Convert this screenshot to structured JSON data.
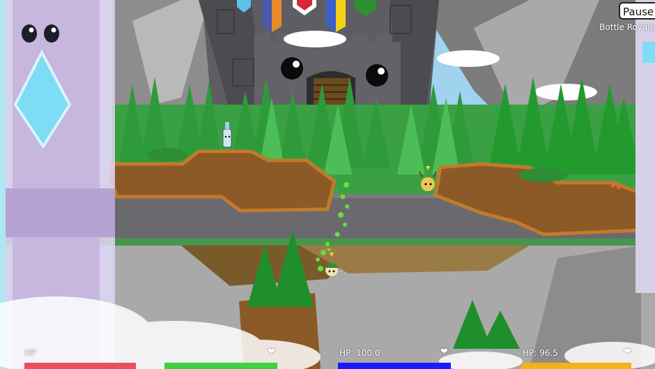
{
  "hud": {
    "pause_label": "Pause",
    "mode_label": "Bottle Royale",
    "players": [
      {
        "hp_label": "HP",
        "heart_icon": "heart-icon",
        "bar_color": "#e8505b",
        "fill_color": "#3fd13f"
      },
      {
        "hp_label": "HP: 100.0",
        "heart_icon": "heart-icon",
        "bar_color": "#1a1aff"
      },
      {
        "hp_label": "HP: 96.5",
        "heart_icon": "heart-icon",
        "bar_color": "#f2b21b"
      }
    ]
  },
  "scene": {
    "characters": [
      "bottle-character",
      "deer-character",
      "green-hat-character"
    ],
    "colors": {
      "sky": "#9fd3ef",
      "mountain": "#8a8a8a",
      "castle": "#5f5f63",
      "tree": "#2e9b3b",
      "dirt": "#8b5a26",
      "crystal": "#7fdcf5",
      "pillar": "#c8b7dd"
    }
  }
}
